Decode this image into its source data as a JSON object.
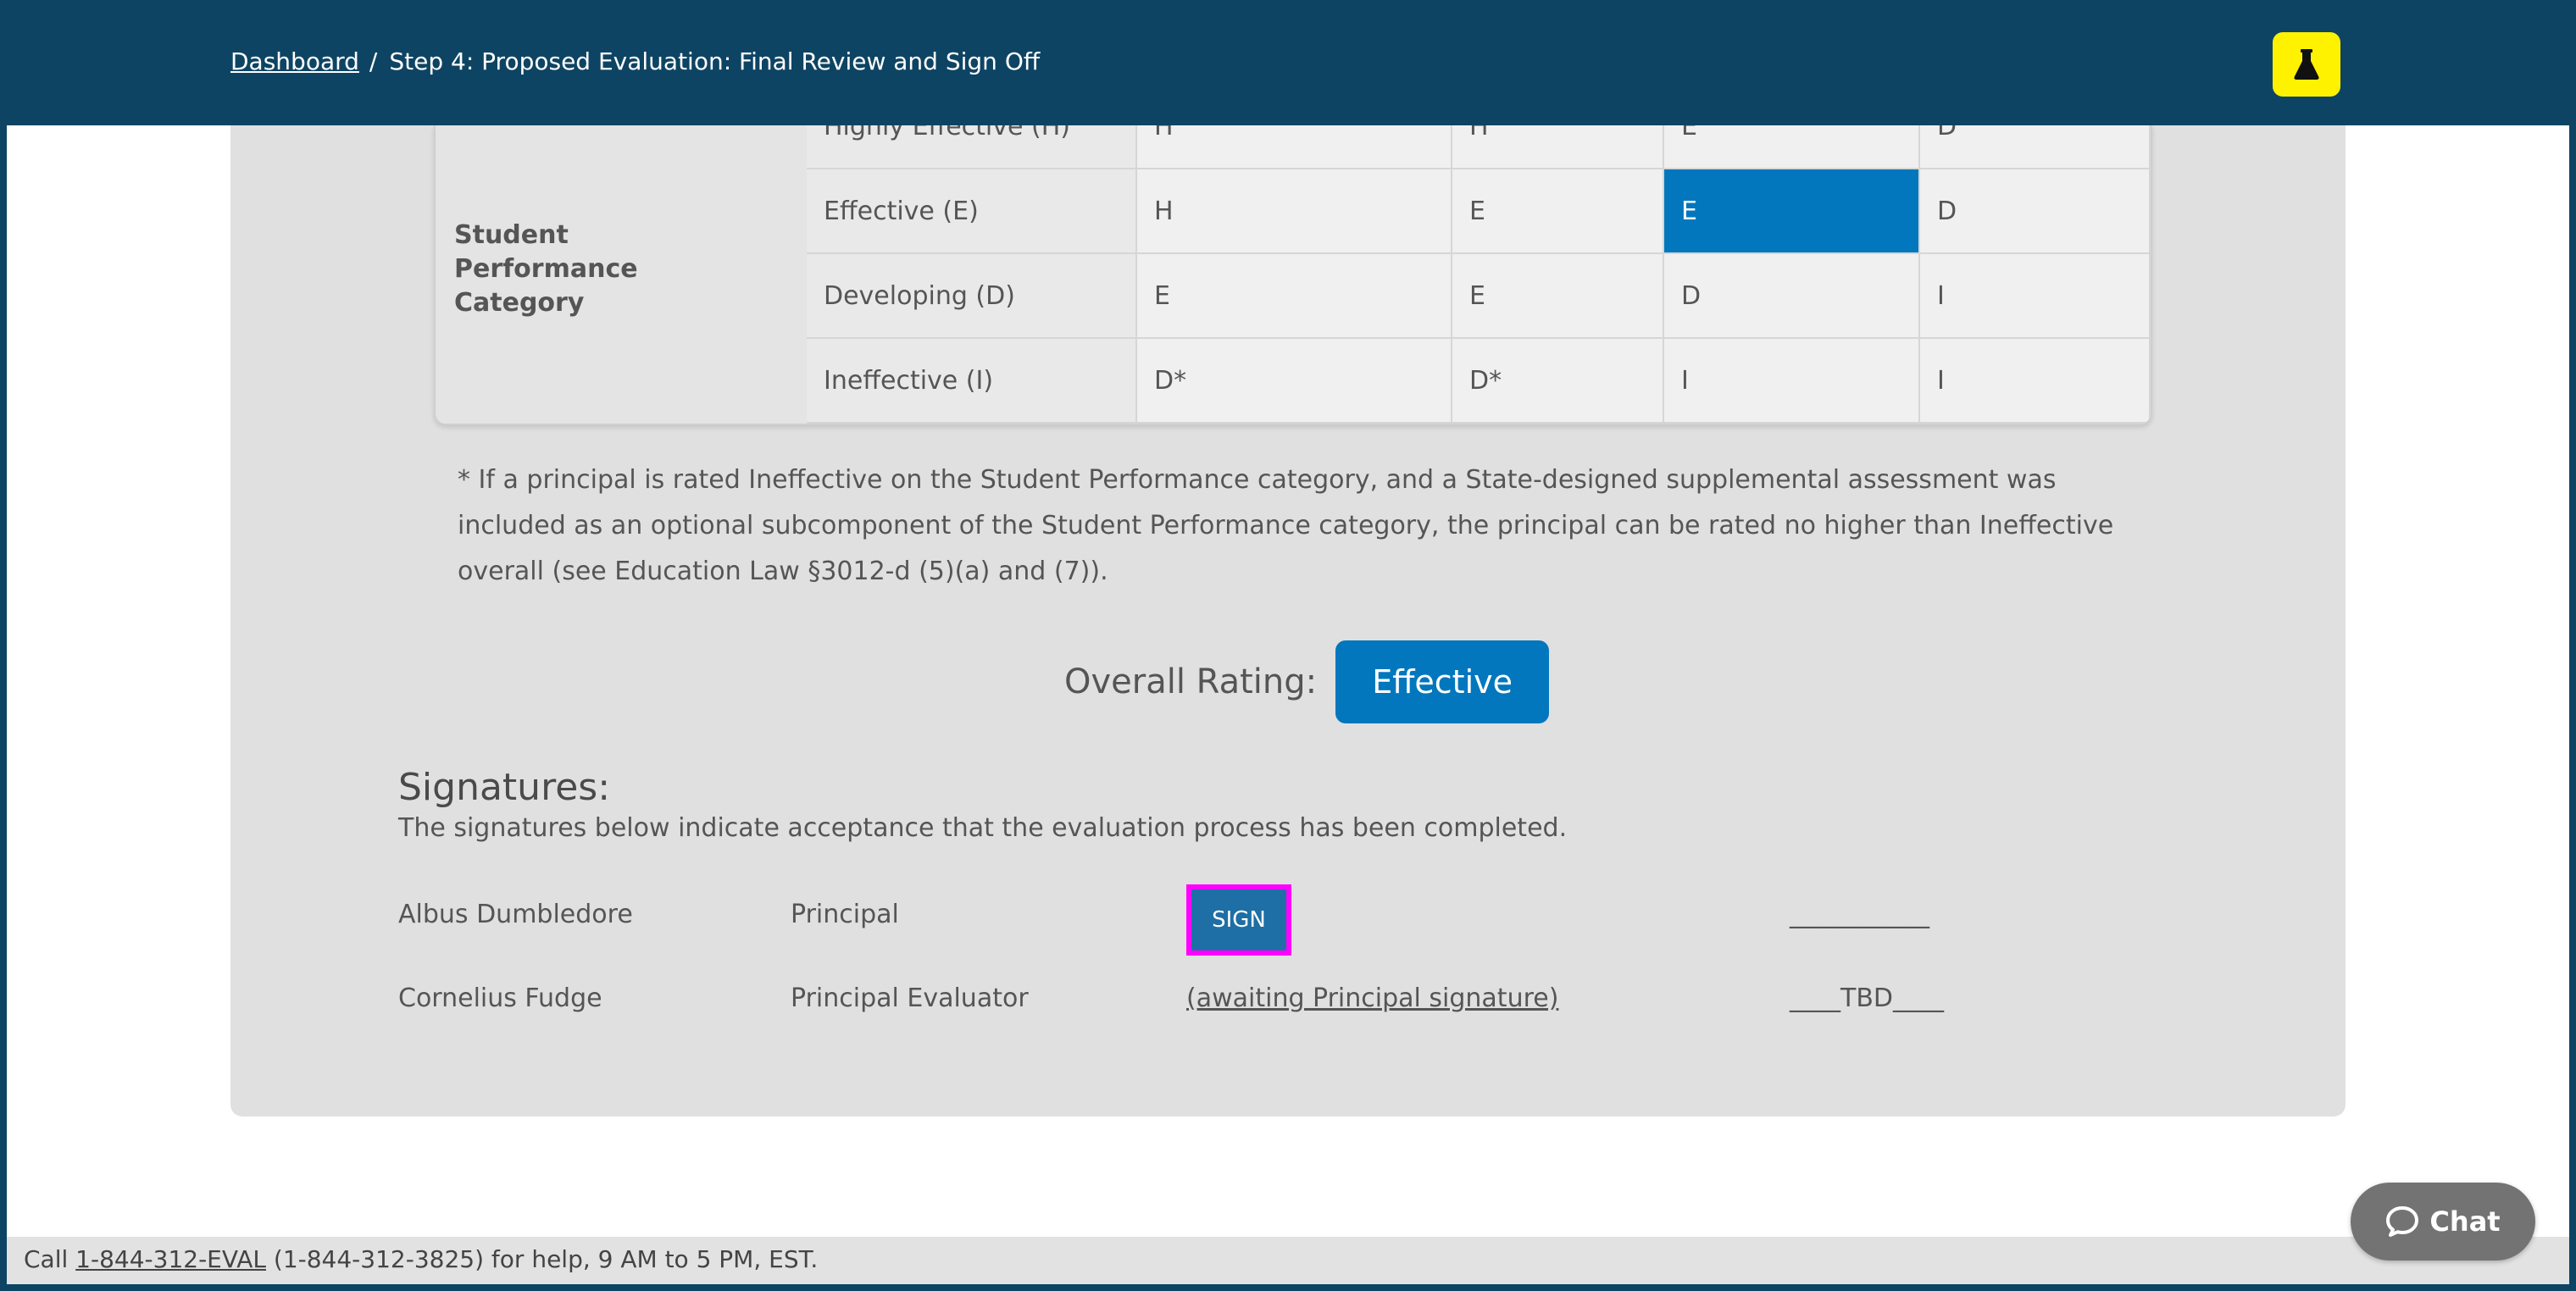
{
  "header": {
    "breadcrumb_link": "Dashboard",
    "breadcrumb_separator": "/",
    "breadcrumb_current": "Step 4: Proposed Evaluation: Final Review and Sign Off",
    "lab_icon": "flask-icon"
  },
  "matrix": {
    "row_group_label": "Student Performance Category",
    "rows": [
      {
        "label": "Highly Effective (H)",
        "cells": [
          "H",
          "H",
          "E",
          "D"
        ]
      },
      {
        "label": "Effective (E)",
        "cells": [
          "H",
          "E",
          "E",
          "D"
        ]
      },
      {
        "label": "Developing (D)",
        "cells": [
          "E",
          "E",
          "D",
          "I"
        ]
      },
      {
        "label": "Ineffective (I)",
        "cells": [
          "D*",
          "D*",
          "I",
          "I"
        ]
      }
    ],
    "highlight": {
      "row": 1,
      "col": 2,
      "color": "#0277bd"
    }
  },
  "footnote": "* If a principal is rated Ineffective on the Student Performance category, and a State-designed supplemental assessment was included as an optional subcomponent of the Student Performance category, the principal can be rated no higher than Ineffective overall (see Education Law §3012-d (5)(a) and (7)).",
  "overall": {
    "label": "Overall Rating:",
    "value": "Effective"
  },
  "signatures": {
    "title": "Signatures:",
    "description": "The signatures below indicate acceptance that the evaluation process has been completed.",
    "rows": [
      {
        "name": "Albus Dumbledore",
        "role": "Principal",
        "action": "SIGN",
        "date": "___________"
      },
      {
        "name": "Cornelius Fudge",
        "role": "Principal Evaluator",
        "action": "(awaiting Principal signature)",
        "date": "____TBD____"
      }
    ]
  },
  "help": {
    "prefix": "Call ",
    "phone_link": "1-844-312-EVAL",
    "suffix": " (1-844-312-3825) for help, 9 AM to 5 PM, EST."
  },
  "chat": {
    "label": "Chat",
    "icon": "chat-bubble-icon"
  },
  "colors": {
    "header": "#0e4463",
    "accent": "#0277bd",
    "lab_button": "#fff200",
    "focus_outline": "#ff00ff"
  }
}
